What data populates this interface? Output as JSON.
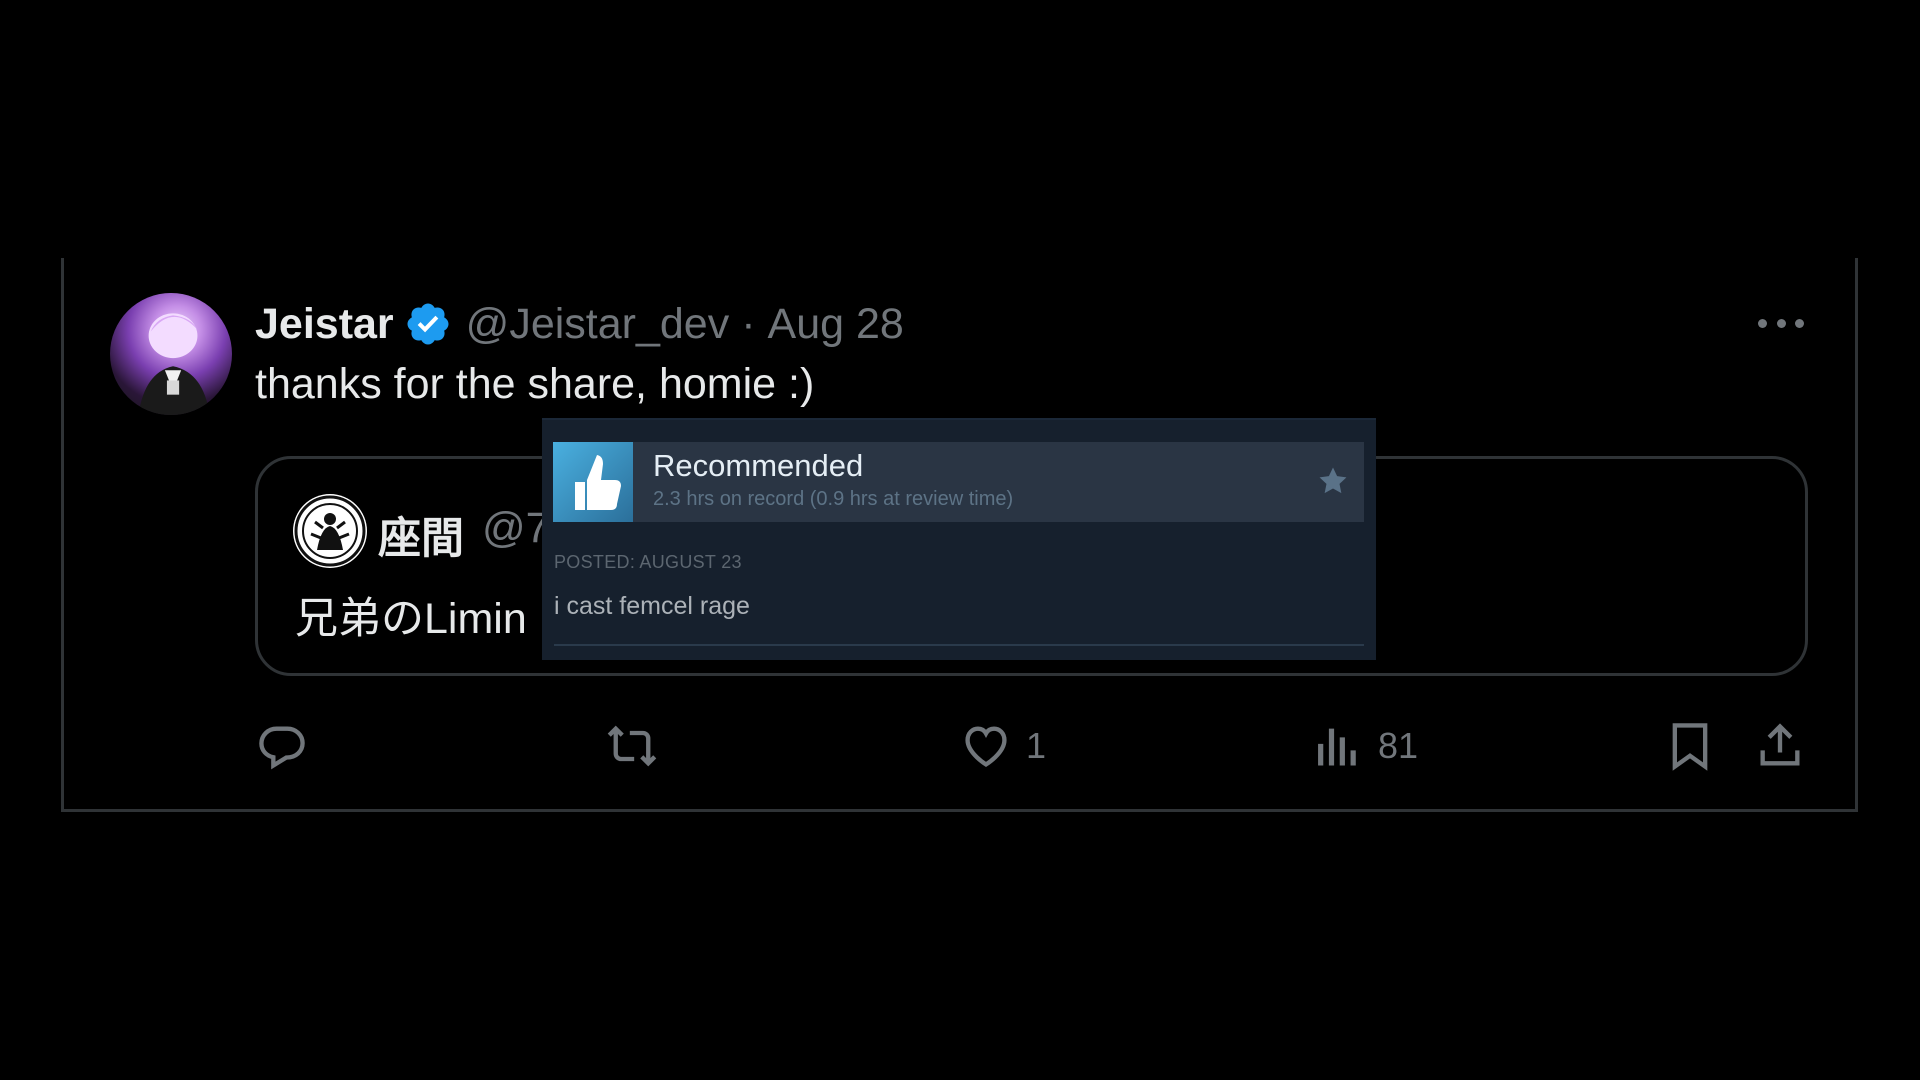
{
  "post": {
    "display_name": "Jeistar",
    "handle": "@Jeistar_dev",
    "separator": "·",
    "date": "Aug 28",
    "text": "thanks for the share, homie :)"
  },
  "quoted_post": {
    "display_name": "座間",
    "handle": "@7",
    "text": "兄弟のLimin"
  },
  "steam_review": {
    "title": "Recommended",
    "hours": "2.3 hrs on record (0.9 hrs at review time)",
    "posted": "POSTED: AUGUST 23",
    "body": "i cast femcel rage"
  },
  "actions": {
    "like_count": "1",
    "views_count": "81"
  },
  "icons": {
    "verified": "verified-badge-icon",
    "more": "more-options-icon",
    "thumb": "thumbs-up-icon",
    "award": "star-icon",
    "reply": "reply-icon",
    "retweet": "retweet-icon",
    "like": "heart-icon",
    "views": "views-chart-icon",
    "bookmark": "bookmark-icon",
    "share": "share-icon"
  },
  "colors": {
    "background": "#000000",
    "primary_text": "#e7e9ea",
    "secondary_text": "#71767b",
    "border": "#2f3336",
    "verified_blue": "#1d9bf0",
    "steam_panel": "#16202d",
    "steam_header": "#2a3544",
    "steam_thumb": "#4ab0e0"
  }
}
